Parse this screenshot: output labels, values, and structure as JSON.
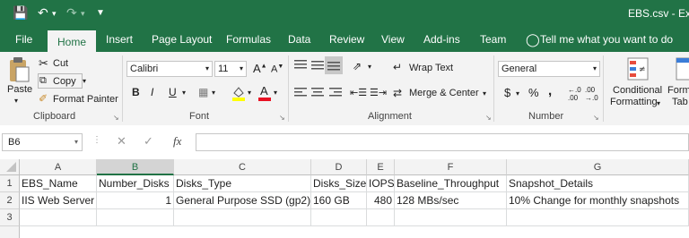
{
  "window": {
    "title": "EBS.csv - Exce"
  },
  "tabs": [
    {
      "label": "File",
      "active": false
    },
    {
      "label": "Home",
      "active": true
    },
    {
      "label": "Insert",
      "active": false
    },
    {
      "label": "Page Layout",
      "active": false
    },
    {
      "label": "Formulas",
      "active": false
    },
    {
      "label": "Data",
      "active": false
    },
    {
      "label": "Review",
      "active": false
    },
    {
      "label": "View",
      "active": false
    },
    {
      "label": "Add-ins",
      "active": false
    },
    {
      "label": "Team",
      "active": false
    }
  ],
  "tell_me": "Tell me what you want to do",
  "ribbon": {
    "clipboard": {
      "paste": "Paste",
      "cut": "Cut",
      "copy": "Copy",
      "format_painter": "Format Painter",
      "label": "Clipboard"
    },
    "font": {
      "name": "Calibri",
      "size": "11",
      "bold": "B",
      "italic": "I",
      "underline": "U",
      "label": "Font"
    },
    "alignment": {
      "wrap_text": "Wrap Text",
      "merge_center": "Merge & Center",
      "label": "Alignment"
    },
    "number": {
      "format": "General",
      "currency": "$",
      "percent": "%",
      "comma": ",",
      "label": "Number"
    },
    "styles": {
      "conditional_formatting_1": "Conditional",
      "conditional_formatting_2": "Formatting",
      "format_as_table_1": "Form",
      "format_as_table_2": "Tab"
    }
  },
  "formula_bar": {
    "name_box": "B6",
    "fx": "fx",
    "formula": ""
  },
  "columns": [
    {
      "letter": "A",
      "selected": false
    },
    {
      "letter": "B",
      "selected": true
    },
    {
      "letter": "C",
      "selected": false
    },
    {
      "letter": "D",
      "selected": false
    },
    {
      "letter": "E",
      "selected": false
    },
    {
      "letter": "F",
      "selected": false
    },
    {
      "letter": "G",
      "selected": false
    }
  ],
  "rows": [
    {
      "num": "1",
      "cells": [
        "EBS_Name",
        "Number_Disks",
        "Disks_Type",
        "Disks_Size",
        "IOPS",
        "Baseline_Throughput",
        "Snapshot_Details"
      ]
    },
    {
      "num": "2",
      "cells": [
        "IIS Web Server",
        "1",
        "General Purpose SSD (gp2)",
        "160 GB",
        "480",
        "128 MBs/sec",
        "10% Change for monthly snapshots"
      ]
    },
    {
      "num": "3",
      "cells": [
        "",
        "",
        "",
        "",
        "",
        "",
        ""
      ]
    }
  ]
}
